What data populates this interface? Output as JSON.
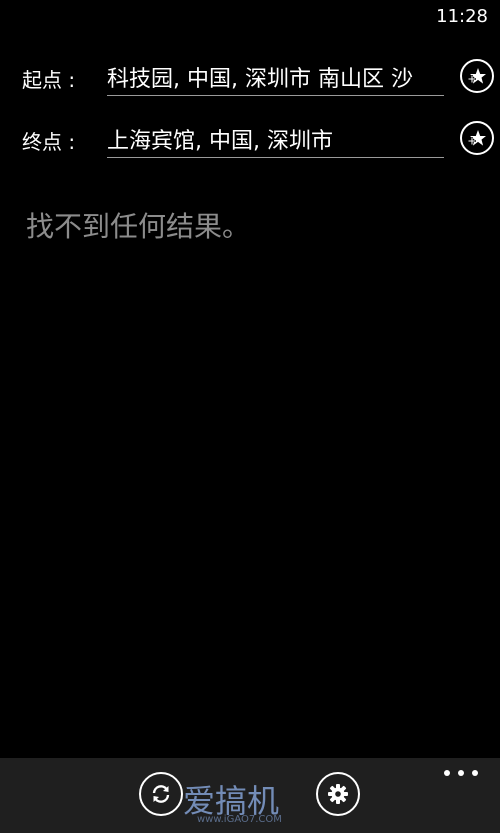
{
  "status_bar": {
    "time": "11:28"
  },
  "route": {
    "start": {
      "label": "起点 :",
      "value": "科技园, 中国, 深圳市 南山区 沙"
    },
    "end": {
      "label": "终点 :",
      "value": "上海宾馆, 中国, 深圳市"
    }
  },
  "results": {
    "empty_message": "找不到任何结果。"
  },
  "app_bar": {
    "buttons": [
      {
        "icon": "refresh-icon"
      },
      {
        "icon": "settings-icon"
      }
    ],
    "more_icon": "more-icon"
  },
  "watermark": {
    "logo_text": "爱搞机",
    "url": "www.iGAO7.COM"
  },
  "colors": {
    "background": "#000000",
    "text": "#ffffff",
    "muted_text": "#8c8c8c",
    "app_bar": "#1f1f1f"
  }
}
